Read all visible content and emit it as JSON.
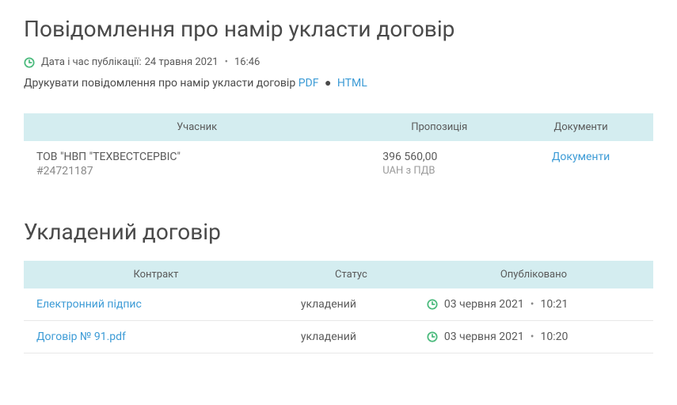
{
  "notice": {
    "title": "Повідомлення про намір укласти договір",
    "pub_label": "Дата і час публікації:",
    "pub_date": "24 травня 2021",
    "pub_time": "16:46",
    "print_text": "Друкувати повідомлення про намір укласти договір",
    "pdf_label": "PDF",
    "html_label": "HTML"
  },
  "participants_table": {
    "headers": {
      "participant": "Учасник",
      "proposal": "Пропозиція",
      "documents": "Документи"
    },
    "rows": [
      {
        "name": "ТОВ \"НВП \"ТЕХВЕСТСЕРВІС\"",
        "id": "#24721187",
        "price": "396 560,00",
        "price_sub": "UAH з ПДВ",
        "docs_link": "Документи"
      }
    ]
  },
  "contract": {
    "title": "Укладений договір",
    "headers": {
      "contract": "Контракт",
      "status": "Статус",
      "published": "Опубліковано"
    },
    "rows": [
      {
        "name": "Електронний підпис",
        "status": "укладений",
        "date": "03 червня 2021",
        "time": "10:21"
      },
      {
        "name": "Договір № 91.pdf",
        "status": "укладений",
        "date": "03 червня 2021",
        "time": "10:20"
      }
    ]
  }
}
